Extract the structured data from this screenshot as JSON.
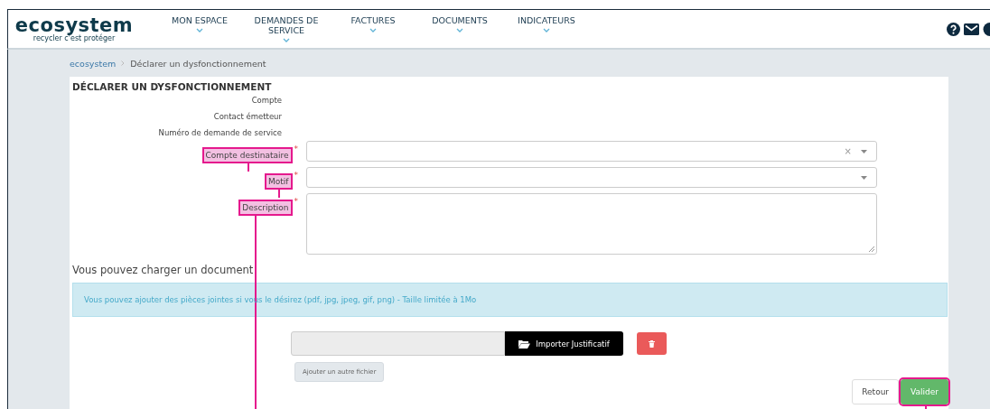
{
  "header": {
    "logo": "ecosystem",
    "tagline": "recycler c'est protéger",
    "nav": [
      {
        "label": "MON ESPACE"
      },
      {
        "label": "DEMANDES DE SERVICE"
      },
      {
        "label": "FACTURES"
      },
      {
        "label": "DOCUMENTS"
      },
      {
        "label": "INDICATEURS"
      }
    ]
  },
  "breadcrumb": [
    "ecosystem",
    "Déclarer un dysfonctionnement"
  ],
  "form": {
    "title": "DÉCLARER UN DYSFONCTIONNEMENT",
    "required_mark": "*",
    "info_fields": [
      "Compte",
      "Contact émetteur",
      "Numéro de demande de service"
    ],
    "fields": [
      {
        "label": "Compte destinataire",
        "kind": "select",
        "required": true,
        "highlighted": true,
        "clear_symbol": "×"
      },
      {
        "label": "Motif",
        "kind": "select",
        "required": true,
        "highlighted": true
      },
      {
        "label": "Description",
        "kind": "textarea",
        "required": true,
        "highlighted": true
      }
    ]
  },
  "upload": {
    "heading": "Vous pouvez charger un document",
    "alert": "Vous pouvez ajouter des pièces jointes si vous le désirez (pdf, jpg, jpeg, gif, png) - Taille limitée à 1Mo",
    "import_button": "Importer Justificatif",
    "add_file_button": "Ajouter un autre fichier"
  },
  "actions": [
    {
      "label": "Retour",
      "kind": "default",
      "highlighted": false
    },
    {
      "label": "Valider",
      "kind": "success",
      "highlighted": true
    }
  ]
}
